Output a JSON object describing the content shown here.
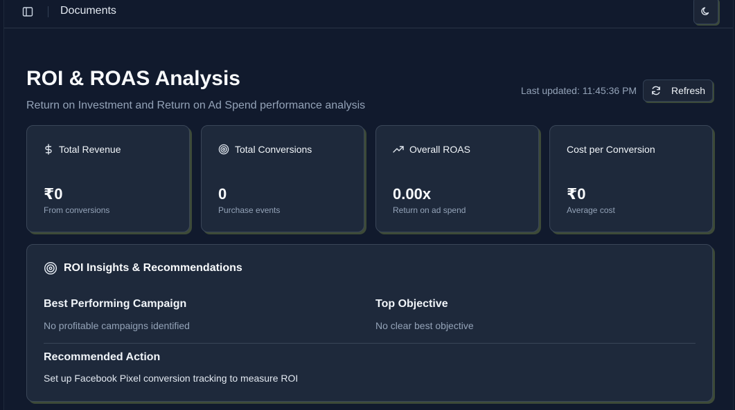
{
  "topbar": {
    "breadcrumb": "Documents",
    "sidebar_toggle_icon": "panel-left-icon",
    "theme_icon": "moon-icon"
  },
  "header": {
    "title": "ROI & ROAS Analysis",
    "subtitle": "Return on Investment and Return on Ad Spend performance analysis",
    "last_updated": "Last updated: 11:45:36 PM",
    "refresh_label": "Refresh",
    "refresh_icon": "refresh-icon"
  },
  "cards": [
    {
      "title": "Total Revenue",
      "icon": "dollar-icon",
      "value": "₹0",
      "desc": "From conversions"
    },
    {
      "title": "Total Conversions",
      "icon": "target-icon",
      "value": "0",
      "desc": "Purchase events"
    },
    {
      "title": "Overall ROAS",
      "icon": "trending-up-icon",
      "value": "0.00x",
      "desc": "Return on ad spend"
    },
    {
      "title": "Cost per Conversion",
      "icon": "",
      "value": "₹0",
      "desc": "Average cost"
    }
  ],
  "insights": {
    "title": "ROI Insights & Recommendations",
    "icon": "target-icon",
    "best_campaign_label": "Best Performing Campaign",
    "best_campaign_text": "No profitable campaigns identified",
    "top_objective_label": "Top Objective",
    "top_objective_text": "No clear best objective",
    "action_label": "Recommended Action",
    "action_text": "Set up Facebook Pixel conversion tracking to measure ROI"
  },
  "colors": {
    "background": "#111a2d",
    "card": "#1e293b",
    "muted_text": "#94a3b8",
    "accent_shadow": "#3d4a38"
  }
}
